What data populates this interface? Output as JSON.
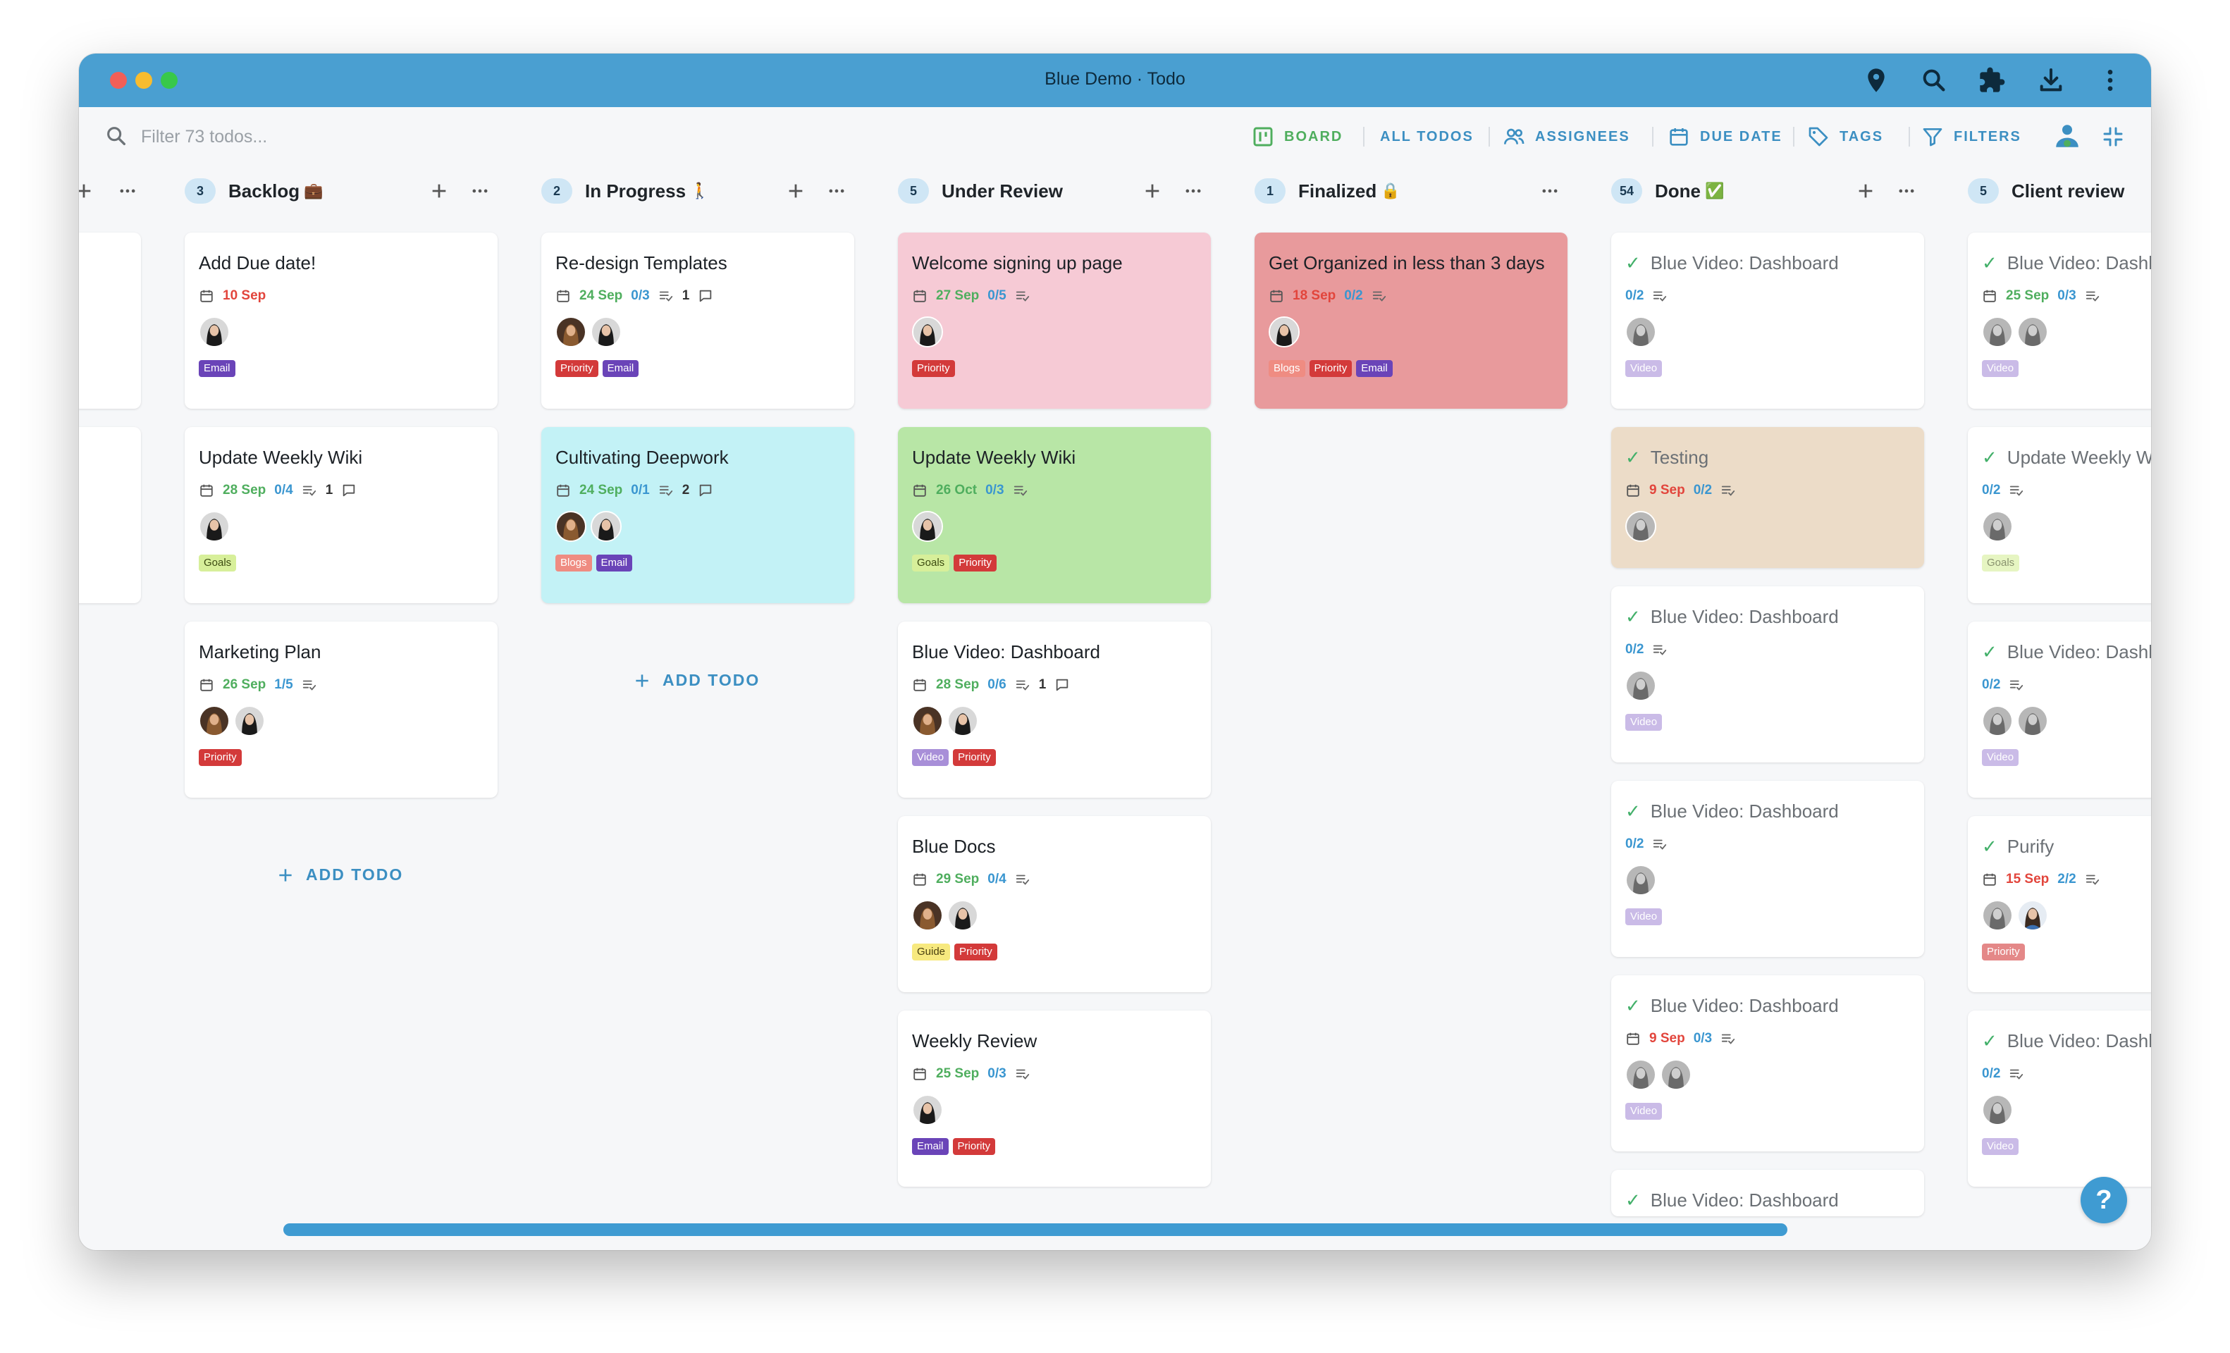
{
  "window": {
    "title": "Blue Demo · Todo"
  },
  "search": {
    "placeholder": "Filter 73 todos..."
  },
  "toolbar": {
    "board": "BOARD",
    "all_todos": "ALL TODOS",
    "assignees": "ASSIGNEES",
    "due_date": "DUE DATE",
    "tags": "TAGS",
    "filters": "FILTERS"
  },
  "colors": {
    "titlebar": "#4a9fd1",
    "accent": "#3c8fc2",
    "priority_tag": "#d33a3a",
    "email_tag": "#6a44b8",
    "goals_tag": "#d7ef9a",
    "guide_tag": "#f7e97f",
    "video_tag": "#a88fd8",
    "blogs_tag": "#ef8c82"
  },
  "columns": [
    {
      "count": "3",
      "title": "Backlog",
      "emoji": "💼",
      "add_label": "ADD TODO",
      "cards": [
        {
          "title": "Add Due date!",
          "date": "10 Sep",
          "checklist": "",
          "comments": "",
          "tags": [
            "Email"
          ]
        },
        {
          "title": "Update Weekly Wiki",
          "date": "28 Sep",
          "checklist": "0/4",
          "comments": "1",
          "tags": [
            "Goals"
          ]
        },
        {
          "title": "Marketing Plan",
          "date": "26 Sep",
          "checklist": "1/5",
          "comments": "",
          "tags": [
            "Priority"
          ]
        }
      ]
    },
    {
      "count": "2",
      "title": "In Progress",
      "emoji": "🚶",
      "add_label": "ADD TODO",
      "cards": [
        {
          "title": "Re-design Templates",
          "date": "24 Sep",
          "checklist": "0/3",
          "comments": "1",
          "tags": [
            "Priority",
            "Email"
          ]
        },
        {
          "title": "Cultivating Deepwork",
          "date": "24 Sep",
          "checklist": "0/1",
          "comments": "2",
          "tags": [
            "Blogs",
            "Email"
          ]
        }
      ]
    },
    {
      "count": "5",
      "title": "Under Review",
      "emoji": "",
      "cards": [
        {
          "title": "Welcome signing up page",
          "date": "27 Sep",
          "checklist": "0/5",
          "comments": "",
          "tags": [
            "Priority"
          ]
        },
        {
          "title": "Update Weekly Wiki",
          "date": "26 Oct",
          "checklist": "0/3",
          "comments": "",
          "tags": [
            "Goals",
            "Priority"
          ]
        },
        {
          "title": "Blue Video: Dashboard",
          "date": "28 Sep",
          "checklist": "0/6",
          "comments": "1",
          "tags": [
            "Video",
            "Priority"
          ]
        },
        {
          "title": "Blue Docs",
          "date": "29 Sep",
          "checklist": "0/4",
          "comments": "",
          "tags": [
            "Guide",
            "Priority"
          ]
        },
        {
          "title": "Weekly Review",
          "date": "25 Sep",
          "checklist": "0/3",
          "comments": "",
          "tags": [
            "Email",
            "Priority"
          ]
        }
      ]
    },
    {
      "count": "1",
      "title": "Finalized",
      "emoji": "🔒",
      "cards": [
        {
          "title": "Get Organized in less than 3 days",
          "date": "18 Sep",
          "checklist": "0/2",
          "comments": "",
          "tags": [
            "Blogs",
            "Priority",
            "Email"
          ]
        }
      ]
    },
    {
      "count": "54",
      "title": "Done",
      "emoji": "✅",
      "cards": [
        {
          "title": "Blue Video: Dashboard",
          "date": "",
          "checklist": "0/2",
          "comments": "",
          "tags": [
            "Video"
          ]
        },
        {
          "title": "Testing",
          "date": "9 Sep",
          "checklist": "0/2",
          "comments": "",
          "tags": []
        },
        {
          "title": "Blue Video: Dashboard",
          "date": "",
          "checklist": "0/2",
          "comments": "",
          "tags": [
            "Video"
          ]
        },
        {
          "title": "Blue Video: Dashboard",
          "date": "",
          "checklist": "0/2",
          "comments": "",
          "tags": [
            "Video"
          ]
        },
        {
          "title": "Blue Video: Dashboard",
          "date": "9 Sep",
          "checklist": "0/3",
          "comments": "",
          "tags": [
            "Video"
          ]
        },
        {
          "title": "Blue Video: Dashboard",
          "date": "",
          "checklist": "",
          "comments": "",
          "tags": []
        }
      ]
    },
    {
      "count": "5",
      "title": "Client review",
      "emoji": "",
      "cards": [
        {
          "title": "Blue Video: Dashb",
          "date": "25 Sep",
          "checklist": "0/3",
          "comments": "",
          "tags": [
            "Video"
          ]
        },
        {
          "title": "Update Weekly W",
          "date": "",
          "checklist": "0/2",
          "comments": "",
          "tags": [
            "Goals"
          ]
        },
        {
          "title": "Blue Video: Dashb",
          "date": "",
          "checklist": "0/2",
          "comments": "",
          "tags": [
            "Video"
          ]
        },
        {
          "title": "Purify",
          "date": "15 Sep",
          "checklist": "2/2",
          "comments": "",
          "tags": [
            "Priority"
          ]
        },
        {
          "title": "Blue Video: Dashb",
          "date": "",
          "checklist": "0/2",
          "comments": "",
          "tags": [
            "Video"
          ]
        }
      ]
    }
  ],
  "help": {
    "label": "?"
  }
}
